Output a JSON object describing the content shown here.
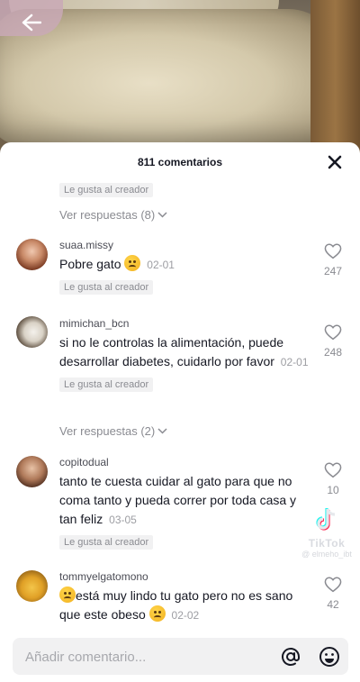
{
  "video": {
    "back_icon": "back-arrow-icon"
  },
  "sheet": {
    "title": "811 comentarios",
    "close_icon": "close-icon"
  },
  "top_badge": "Le gusta al creador",
  "top_replies": "Ver respuestas (8)",
  "comments": [
    {
      "user": "suaa.missy",
      "text": "Pobre gato",
      "emoji_after": "worried-face-emoji",
      "date": "02-01",
      "badge": "Le gusta al creador",
      "likes": "247"
    },
    {
      "user": "mimichan_bcn",
      "text": "si no le controlas la alimentación, puede desarrollar diabetes, cuidarlo por favor",
      "date": "02-01",
      "badge": "Le gusta al creador",
      "likes": "248",
      "replies": "Ver respuestas (2)"
    },
    {
      "user": "copitodual",
      "text": "tanto te cuesta cuidar al gato para que no coma tanto y pueda correr por toda casa y tan feliz",
      "date": "03-05",
      "badge": "Le gusta al creador",
      "likes": "10"
    },
    {
      "user": "tommyelgatomono",
      "text_before_emoji": "",
      "text": "está muy lindo tu gato pero no es sano que este obeso",
      "date": "02-02",
      "likes": "42"
    }
  ],
  "watermark": {
    "brand": "TikTok",
    "handle": "@ elmeho_ibt"
  },
  "input": {
    "placeholder": "Añadir comentario...",
    "mention_icon": "at-sign-icon",
    "emoji_icon": "emoji-icon"
  },
  "colors": {
    "sheet_bg": "#ffffff",
    "text_primary": "#161823",
    "text_secondary": "#8a8b91",
    "badge_bg": "#f1f1f2"
  }
}
